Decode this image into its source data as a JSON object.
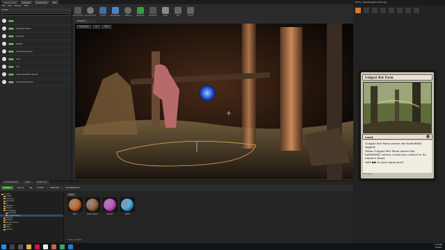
{
  "editor": {
    "tabs": [
      "Unreal Projects",
      "Sebastian",
      "DreamCreek",
      "UE4"
    ],
    "menu": [
      "File",
      "Edit",
      "Window",
      "Help"
    ],
    "toolbar": [
      "Save Current",
      "Source Control",
      "Content",
      "Marketplace",
      "Settings",
      "Blueprints",
      "Cinematics",
      "Build",
      "Play",
      "Launch"
    ],
    "modes_header": "Modes",
    "place_items": [
      {
        "tag": "Static",
        "name": ""
      },
      {
        "tag": "Static",
        "name": "Mossbody Enders"
      },
      {
        "tag": "Static",
        "name": "Pig Grass"
      },
      {
        "tag": "Static",
        "name": "Pig Bud"
      },
      {
        "tag": "Static",
        "name": "Shade Source Actor"
      },
      {
        "tag": "Static",
        "name": "Actor"
      },
      {
        "tag": "Static",
        "name": "VFX"
      },
      {
        "tag": "Static",
        "name": "Vertex Volumetric Window"
      },
      {
        "tag": "Static",
        "name": "Floating Ambient 31"
      }
    ],
    "viewport_tab": "Viewport 1",
    "viewport_pills": [
      "Perspective",
      "Lit",
      "Show"
    ]
  },
  "content_browser": {
    "tabs": [
      "Content Browser",
      "Levels",
      "Output Log"
    ],
    "add_new": "Add New",
    "save_all": "Save All",
    "breadcrumb": [
      "Content",
      "SketchFab",
      "DrywallSpheres"
    ],
    "filters": "Filters",
    "folders": [
      "Content",
      "Assets",
      "Geometry",
      "Blueprints",
      "FX",
      "Materials",
      "Meshes",
      "MonsterPack",
      "SketchFab",
      "DrywallSpheres",
      "Textures",
      "Widgets",
      "Starter Content",
      "Sounds",
      "Maps",
      "Particles"
    ],
    "selected_folder": "DrywallSpheres",
    "assets": [
      {
        "name": "Ball 1",
        "color": "#c86d2c"
      },
      {
        "name": "Spawn Sphere",
        "color": "#9a6b45"
      },
      {
        "name": "Ambient",
        "color": "#d14fd1"
      },
      {
        "name": "M_Ball",
        "color": "#4fb2e3"
      }
    ],
    "status": "4 items (1 selected)"
  },
  "photos": {
    "title": "Photos - mtg-100-golgari-rot-farm.jpg"
  },
  "card": {
    "name": "Golgari Rot Farm",
    "type": "Land",
    "text1": "Golgari Rot Farm enters the battlefield tapped.",
    "text2": "When Golgari Rot Farm enters the battlefield, return a land you control to its owner's hand.",
    "text3": "Add ◆◆ to your mana pool.",
    "footer": "RAV 279/286 C"
  },
  "taskbar": {
    "time": "11:28 AM",
    "date": "7/4/2017"
  },
  "colors": {
    "accent": "#d9782a",
    "unreal_green": "#3c7d2f",
    "folder": "#c9a24a"
  }
}
